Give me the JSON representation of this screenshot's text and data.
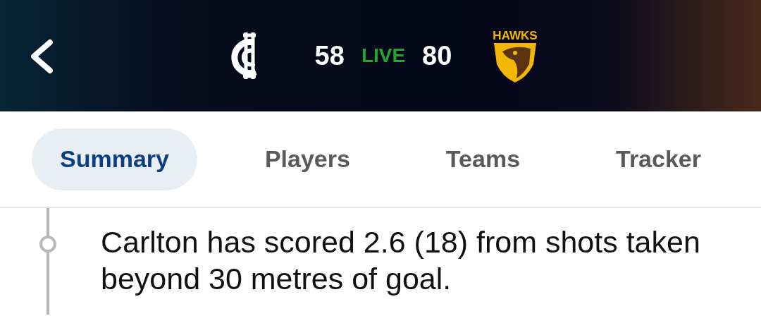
{
  "header": {
    "home_score": "58",
    "status": "LIVE",
    "away_score": "80",
    "away_logo_text": "HAWKS"
  },
  "tabs": [
    {
      "label": "Summary",
      "selected": true
    },
    {
      "label": "Players",
      "selected": false
    },
    {
      "label": "Teams",
      "selected": false
    },
    {
      "label": "Tracker",
      "selected": false
    }
  ],
  "timeline": [
    {
      "text": "Carlton has scored 2.6 (18) from shots taken beyond 30 metres of goal."
    }
  ]
}
